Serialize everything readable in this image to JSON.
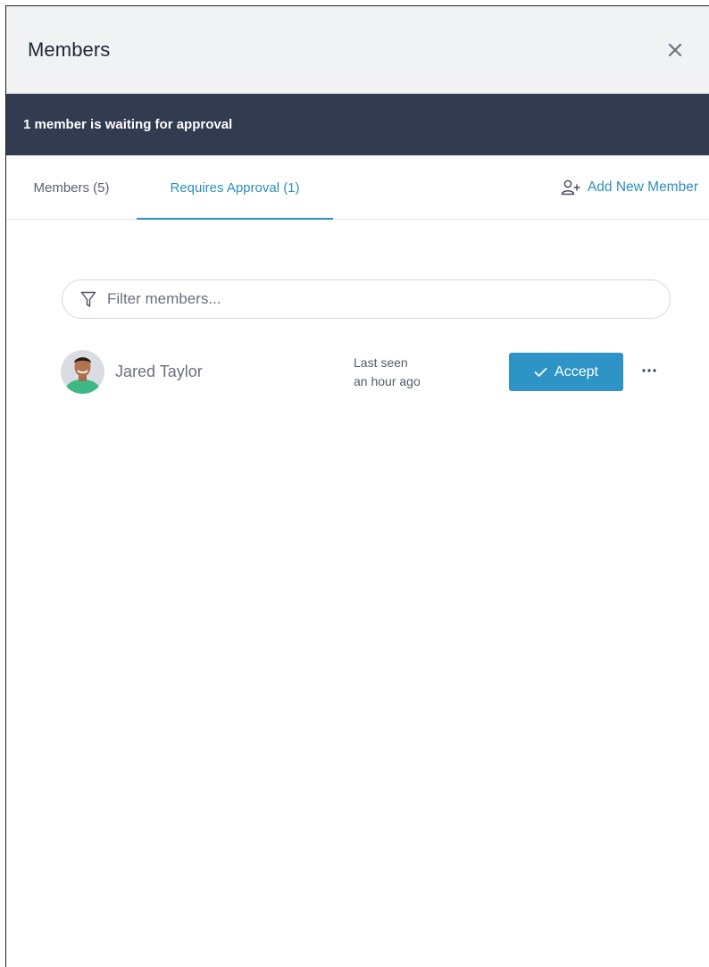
{
  "header": {
    "title": "Members",
    "close_icon": "close-icon"
  },
  "banner": {
    "text": "1 member is waiting for approval"
  },
  "tabs": [
    {
      "label": "Members (5)",
      "active": false
    },
    {
      "label": "Requires Approval (1)",
      "active": true
    }
  ],
  "add_member": {
    "label": "Add New Member",
    "icon": "add-user-icon"
  },
  "filter": {
    "placeholder": "Filter members...",
    "value": "",
    "icon": "filter-icon"
  },
  "members": [
    {
      "name": "Jared Taylor",
      "last_seen_label": "Last seen",
      "last_seen_value": "an hour ago",
      "accept_label": "Accept",
      "accept_icon": "checkmark-icon",
      "more_icon": "more-options-icon"
    }
  ],
  "colors": {
    "accent": "#2c8fbd",
    "banner_bg": "#323b50",
    "header_bg": "#f1f2f3",
    "button_bg": "#2e94c5"
  }
}
